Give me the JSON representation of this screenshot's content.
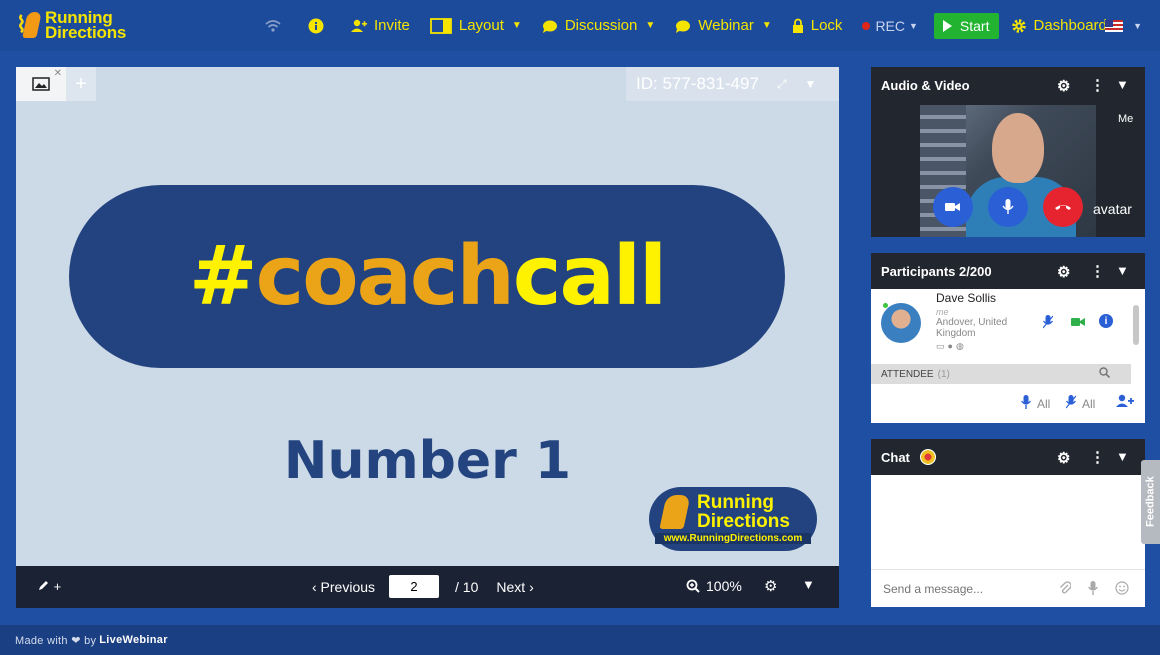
{
  "app": {
    "logo_line1": "Running",
    "logo_line2": "Directions"
  },
  "toolbar": {
    "invite": "Invite",
    "layout": "Layout",
    "discussion": "Discussion",
    "webinar": "Webinar",
    "lock": "Lock",
    "rec": "REC",
    "start": "Start",
    "dashboard": "Dashboard"
  },
  "presentation": {
    "meeting_id": "ID: 577-831-497",
    "slide": {
      "hash_part1": "#",
      "hash_part2": "coach",
      "hash_part3": "call",
      "subtitle": "Number 1",
      "logo_line1": "Running",
      "logo_line2": "Directions",
      "logo_url": "www.RunningDirections.com"
    },
    "controls": {
      "previous": "‹ Previous",
      "page": "2",
      "total": "/ 10",
      "next": "Next ›",
      "zoom": "100%"
    }
  },
  "audio_video": {
    "title": "Audio & Video",
    "me_label": "Me",
    "avatar_label": "avatar"
  },
  "participants": {
    "title": "Participants 2/200",
    "rows": [
      {
        "name": "Dave Sollis",
        "role": "me",
        "location": "Andover, United Kingdom"
      }
    ],
    "attendee_label": "ATTENDEE",
    "attendee_count": "(1)",
    "mute_all_1": "All",
    "mute_all_2": "All"
  },
  "chat": {
    "title": "Chat",
    "input_placeholder": "Send a message..."
  },
  "feedback_label": "Feedback",
  "footer": {
    "made_with": "Made with ❤ by",
    "brand": "LiveWebinar"
  },
  "colors": {
    "accent_yellow": "#f4e400",
    "start_green": "#22b330",
    "topbar_blue": "#1d4b9c",
    "panel_dark": "#22272f"
  }
}
